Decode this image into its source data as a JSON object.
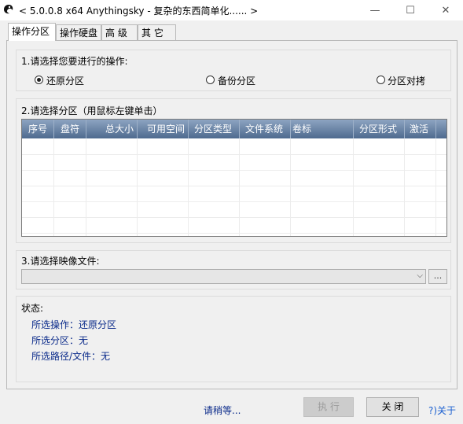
{
  "window": {
    "title": "< 5.0.0.8 x64 Anythingsky - 复杂的东西简单化...... >",
    "minimize_glyph": "—",
    "maximize_glyph": "☐",
    "close_glyph": "✕"
  },
  "tabs": [
    "操作分区",
    "操作硬盘",
    "高 级",
    "其 它"
  ],
  "operation": {
    "label": "1.请选择您要进行的操作:",
    "options": [
      {
        "label": "还原分区",
        "checked": true
      },
      {
        "label": "备份分区",
        "checked": false
      },
      {
        "label": "分区对拷",
        "checked": false
      }
    ]
  },
  "partition": {
    "label": "2.请选择分区（用鼠标左键单击）",
    "columns": [
      "序号",
      "盘符",
      "总大小",
      "可用空间",
      "分区类型",
      "文件系统",
      "卷标",
      "分区形式",
      "激活"
    ],
    "rows": []
  },
  "image_file": {
    "label": "3.请选择映像文件:",
    "value": "",
    "browse_label": "..."
  },
  "status": {
    "label": "状态:",
    "lines": [
      "所选操作：还原分区",
      "所选分区：无",
      "所选路径/文件：无"
    ]
  },
  "footer": {
    "waiting_text": "请稍等...",
    "execute_label": "执 行",
    "close_label": "关 闭",
    "about_label": "?)关于"
  }
}
